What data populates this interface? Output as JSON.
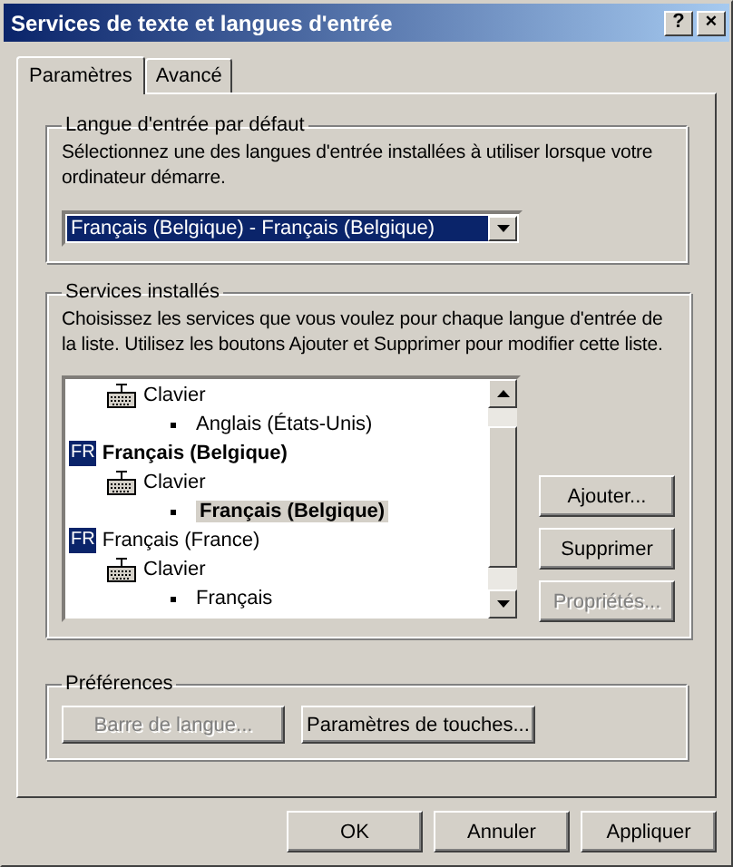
{
  "window": {
    "title": "Services de texte et langues d'entrée",
    "buttons": [
      "?",
      "×"
    ]
  },
  "tabs": [
    {
      "label": "Paramètres",
      "selected": true
    },
    {
      "label": "Avancé",
      "selected": false
    }
  ],
  "default_language": {
    "title": "Langue d'entrée par défaut",
    "description": "Sélectionnez une des langues d'entrée installées à utiliser lorsque votre ordinateur démarre.",
    "value": "Français (Belgique) - Français (Belgique)"
  },
  "installed_services": {
    "title": "Services installés",
    "description": "Choisissez les services que vous voulez pour chaque langue d'entrée de la liste. Utilisez les boutons Ajouter et Supprimer pour modifier cette liste.",
    "tree": [
      {
        "kind": "category",
        "label": "Clavier",
        "children": [
          {
            "kind": "layout",
            "label": "Anglais (États-Unis)",
            "default": false,
            "selected": false
          }
        ]
      },
      {
        "kind": "language",
        "badge": "FR",
        "label": "Français (Belgique)",
        "default": true,
        "children": [
          {
            "kind": "category",
            "label": "Clavier",
            "children": [
              {
                "kind": "layout",
                "label": "Français (Belgique)",
                "default": true,
                "selected": true
              }
            ]
          }
        ]
      },
      {
        "kind": "language",
        "badge": "FR",
        "label": "Français (France)",
        "default": false,
        "children": [
          {
            "kind": "category",
            "label": "Clavier",
            "children": [
              {
                "kind": "layout",
                "label": "Français",
                "default": false,
                "selected": false
              }
            ]
          }
        ]
      }
    ],
    "buttons": [
      {
        "label": "Ajouter...",
        "disabled": false
      },
      {
        "label": "Supprimer",
        "disabled": false
      },
      {
        "label": "Propriétés...",
        "disabled": true
      }
    ]
  },
  "preferences": {
    "title": "Préférences",
    "buttons": [
      {
        "label": "Barre de langue...",
        "disabled": true
      },
      {
        "label": "Paramètres de touches...",
        "disabled": false
      }
    ]
  },
  "footer_buttons": [
    {
      "label": "OK",
      "disabled": false
    },
    {
      "label": "Annuler",
      "disabled": false
    },
    {
      "label": "Appliquer",
      "disabled": false
    }
  ]
}
